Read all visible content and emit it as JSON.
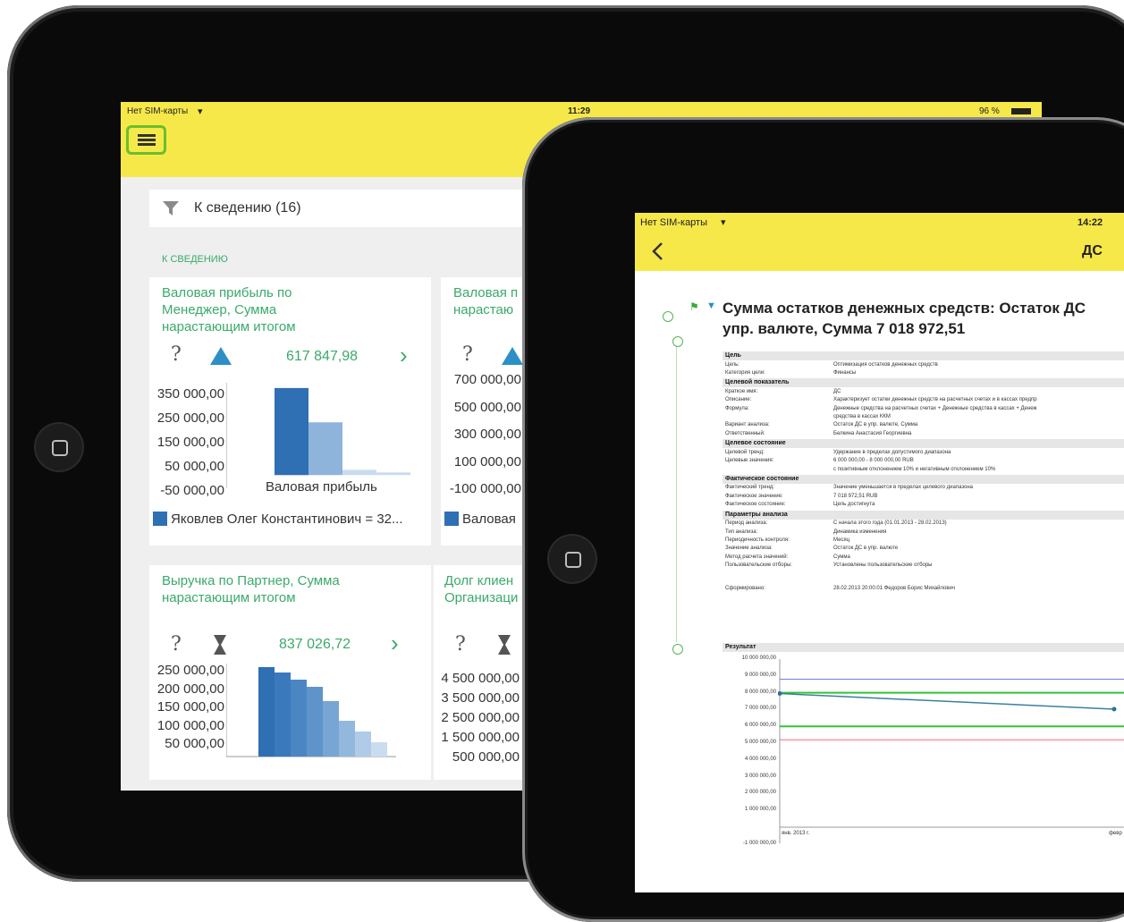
{
  "back": {
    "status": {
      "carrier": "Нет SIM-карты",
      "time": "11:29",
      "battery": "96 %"
    },
    "filter_label": "К сведению (16)",
    "section_label": "К СВЕДЕНИЮ",
    "cards": [
      {
        "title": [
          "Валовая прибыль по",
          "Менеджер, Сумма",
          "нарастающим итогом"
        ],
        "value": "617 847,98",
        "yticks": [
          "350 000,00",
          "250 000,00",
          "150 000,00",
          "50 000,00",
          "-50 000,00"
        ],
        "xlabel": "Валовая прибыль",
        "legend": "Яковлев Олег Константинович = 32..."
      },
      {
        "title": [
          "Валовая п",
          "нарастаю"
        ],
        "yticks": [
          "700 000,00",
          "500 000,00",
          "300 000,00",
          "100 000,00",
          "-100 000,00"
        ],
        "legend": "Валовая"
      },
      {
        "title": [
          "Выручка по Партнер, Сумма",
          "нарастающим итогом"
        ],
        "value": "837 026,72",
        "yticks": [
          "250 000,00",
          "200 000,00",
          "150 000,00",
          "100 000,00",
          "50 000,00"
        ]
      },
      {
        "title": [
          "Долг клиен",
          "Организаци"
        ],
        "yticks": [
          "4 500 000,00",
          "3 500 000,00",
          "2 500 000,00",
          "1 500 000,00",
          "500 000,00"
        ]
      }
    ],
    "question": "?",
    "chevron": "›"
  },
  "front": {
    "status": {
      "carrier": "Нет SIM-карты",
      "time": "14:22"
    },
    "nav_title": "ДС",
    "heading": [
      "Сумма остатков денежных средств: Остаток ДС",
      "упр. валюте, Сумма 7 018 972,51"
    ],
    "details": [
      {
        "section": "Цель"
      },
      {
        "k": "Цель:",
        "v": "Оптимизация остатков денежных средств"
      },
      {
        "k": "Категория цели:",
        "v": "Финансы"
      },
      {
        "section": "Целевой показатель"
      },
      {
        "k": "Краткое имя:",
        "v": "ДС"
      },
      {
        "k": "Описание:",
        "v": "Характеризует остатки денежных средств на расчетных счетах и в кассах предпр"
      },
      {
        "k": "Формула:",
        "v": "Денежные средства на расчетных счетах + Денежные средства в кассах + Денеж"
      },
      {
        "k": "",
        "v": "средства в кассах ККМ"
      },
      {
        "k": "Вариант анализа:",
        "v": "Остаток ДС в упр. валюте, Сумма"
      },
      {
        "k": "Ответственный:",
        "v": "Белкина Анастасия Георгиевна"
      },
      {
        "section": "Целевое состояние"
      },
      {
        "k": "Целевой тренд:",
        "v": "Удержание в пределах допустимого диапазона"
      },
      {
        "k": "Целевые значения:",
        "v": "6 000 000,00 - 8 000 000,00 RUB"
      },
      {
        "k": "",
        "v": "с позитивным отклонением 10% и негативным отклонением 10%"
      },
      {
        "section": "Фактическое состояние"
      },
      {
        "k": "Фактический тренд:",
        "v": "Значение уменьшается в пределах целевого диапазона"
      },
      {
        "k": "Фактическое значение:",
        "v": "7 018 972,51 RUB"
      },
      {
        "k": "Фактическое состояние:",
        "v": "Цель достигнута"
      },
      {
        "section": "Параметры анализа"
      },
      {
        "k": "Период анализа:",
        "v": "С начала этого года (01.01.2013 - 28.02.2013)"
      },
      {
        "k": "Тип анализа:",
        "v": "Динамика изменения"
      },
      {
        "k": "Периодичность контроля:",
        "v": "Месяц"
      },
      {
        "k": "Значение анализа:",
        "v": "Остаток ДС в упр. валюте"
      },
      {
        "k": "Метод расчета значений:",
        "v": "Сумма"
      },
      {
        "k": "Пользовательские отборы:",
        "v": "Установлены пользовательские отборы"
      },
      {
        "k": "",
        "v": ""
      },
      {
        "k": "Сформировано:",
        "v": "28.02.2013 20:00:01 Федоров Борис Михайлович"
      }
    ],
    "result_label": "Результат",
    "result_yticks": [
      "10 000 000,00",
      "9 000 000,00",
      "8 000 000,00",
      "7 000 000,00",
      "6 000 000,00",
      "5 000 000,00",
      "4 000 000,00",
      "3 000 000,00",
      "2 000 000,00",
      "1 000 000,00",
      "",
      "-1 000 000,00"
    ],
    "result_x": [
      "янв. 2013 г.",
      "февр"
    ]
  },
  "chart_data": [
    {
      "type": "bar",
      "values": [
        330000,
        200000,
        20000,
        10000
      ],
      "ylim": [
        -50000,
        350000
      ],
      "xlabel": "Валовая прибыль",
      "legend": "bottom"
    },
    {
      "type": "bar",
      "values": [
        250000,
        235000,
        215000,
        195000,
        155000,
        100000,
        70000,
        40000
      ],
      "ylim": [
        0,
        250000
      ]
    },
    {
      "type": "line",
      "x": [
        "янв. 2013 г.",
        "февр"
      ],
      "series": [
        {
          "values": [
            7950000,
            7018972.51
          ]
        }
      ],
      "bands": [
        {
          "value": 8800000,
          "color": "#7a7ae8"
        },
        {
          "value": 8000000,
          "color": "#35c235"
        },
        {
          "value": 6000000,
          "color": "#35c235"
        },
        {
          "value": 5200000,
          "color": "#f07070"
        }
      ],
      "ylim": [
        -1000000,
        10000000
      ]
    }
  ],
  "colors": {
    "yellow": "#f7e84a",
    "green": "#3aaa6a",
    "bar_dark": "#2f6fb3",
    "bar_mid": "#8fb4dc",
    "bar_light": "#c9dcef"
  }
}
